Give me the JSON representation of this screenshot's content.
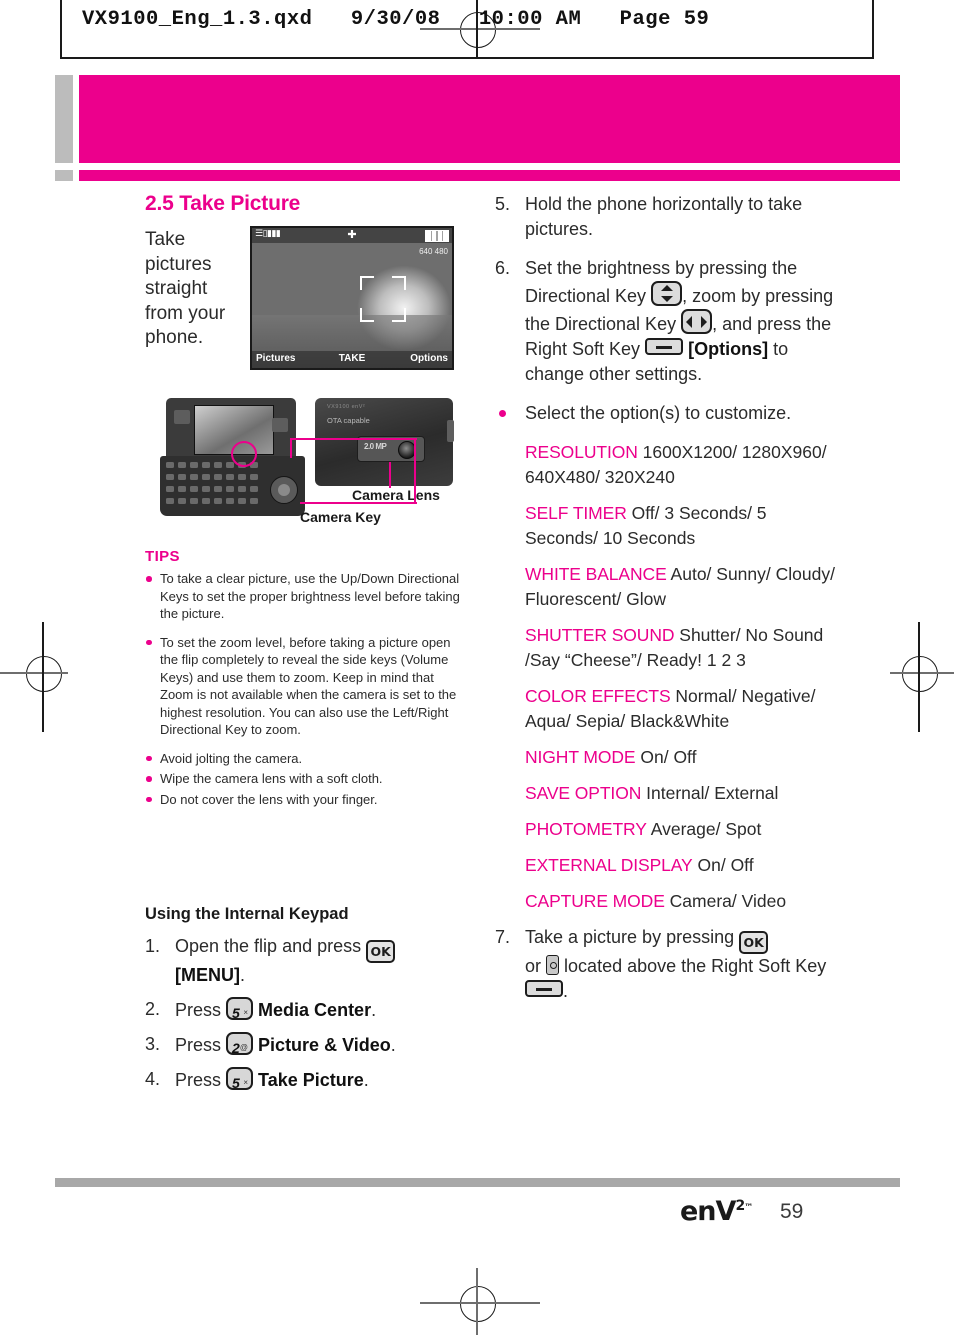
{
  "print_header": {
    "text": "VX9100_Eng_1.3.qxd   9/30/08   10:00 AM   Page 59"
  },
  "colors": {
    "accent_magenta": "#EC008C",
    "gray_tab": "#BCBCBC",
    "footer_rule": "#A8A8A8",
    "body_text": "#2B2B2B"
  },
  "left_column": {
    "section_title": "2.5 Take Picture",
    "intro_text": "Take pictures straight from your phone.",
    "camera_screen": {
      "status_left": "EV D",
      "status_center": "crosshair-icon",
      "resolution_badge": "640 480",
      "softkey_left": "Pictures",
      "softkey_center": "TAKE",
      "softkey_right": "Options"
    },
    "diagram": {
      "callout_lens": "Camera Lens",
      "callout_key": "Camera Key",
      "back_brand": "VX9100 enV²",
      "back_label": "OTA capable",
      "megapixel_label": "2.0 MP"
    },
    "tips": {
      "title": "TIPS",
      "items": [
        "To take a clear picture, use the Up/Down Directional Keys to set the proper brightness level before taking the picture.",
        "To set the zoom level, before taking a picture open the flip completely to reveal the side keys (Volume Keys) and use them to zoom. Keep in mind that Zoom is not available when the camera is set to the highest resolution. You can also use the Left/Right Directional Key to zoom.",
        "Avoid jolting the camera.",
        "Wipe the camera lens with a soft cloth.",
        "Do not cover the lens with your finger."
      ]
    },
    "keypad_section": {
      "heading": "Using the Internal Keypad",
      "steps": [
        {
          "num": "1.",
          "pre": "Open the flip and press",
          "key": "OK",
          "post_bold": "[MENU]",
          "post": "."
        },
        {
          "num": "2.",
          "pre": "Press",
          "key_digit": "5",
          "key_sup": "×",
          "post_bold": "Media Center",
          "post": "."
        },
        {
          "num": "3.",
          "pre": "Press",
          "key_digit": "2",
          "key_sup": "@",
          "post_bold": "Picture & Video",
          "post": "."
        },
        {
          "num": "4.",
          "pre": "Press",
          "key_digit": "5",
          "key_sup": "×",
          "post_bold": "Take Picture",
          "post": "."
        }
      ]
    }
  },
  "right_column": {
    "step5": {
      "num": "5.",
      "text": "Hold the phone horizontally to take pictures."
    },
    "step6": {
      "num": "6.",
      "part1": "Set the brightness by pressing the Directional Key",
      "part2": ", zoom by pressing the Directional Key",
      "part3": ", and press the Right Soft Key",
      "part4_bold": "[Options]",
      "part5": "to change other settings."
    },
    "customize_bullet": "Select the option(s) to customize.",
    "options": [
      {
        "key": "RESOLUTION",
        "value": "1600X1200/ 1280X960/ 640X480/ 320X240"
      },
      {
        "key": "SELF TIMER",
        "value": "Off/ 3 Seconds/ 5 Seconds/ 10 Seconds"
      },
      {
        "key": "WHITE BALANCE",
        "value": "Auto/ Sunny/ Cloudy/ Fluorescent/ Glow"
      },
      {
        "key": "SHUTTER SOUND",
        "value": "Shutter/ No Sound /Say “Cheese”/ Ready! 1 2 3"
      },
      {
        "key": "COLOR EFFECTS",
        "value": "Normal/ Negative/ Aqua/ Sepia/ Black&White"
      },
      {
        "key": "NIGHT MODE",
        "value": "On/ Off"
      },
      {
        "key": "SAVE OPTION",
        "value": "Internal/ External"
      },
      {
        "key": "PHOTOMETRY",
        "value": "Average/ Spot"
      },
      {
        "key": "EXTERNAL DISPLAY",
        "value": "On/ Off"
      },
      {
        "key": "CAPTURE MODE",
        "value": "Camera/ Video"
      }
    ],
    "step7": {
      "num": "7.",
      "part1": "Take a picture by pressing",
      "part2": "or",
      "part3": "located above the Right Soft Key",
      "part4": "."
    }
  },
  "footer": {
    "logo_text": "enV",
    "logo_sup": "2",
    "logo_tm": "™",
    "page_number": "59"
  }
}
